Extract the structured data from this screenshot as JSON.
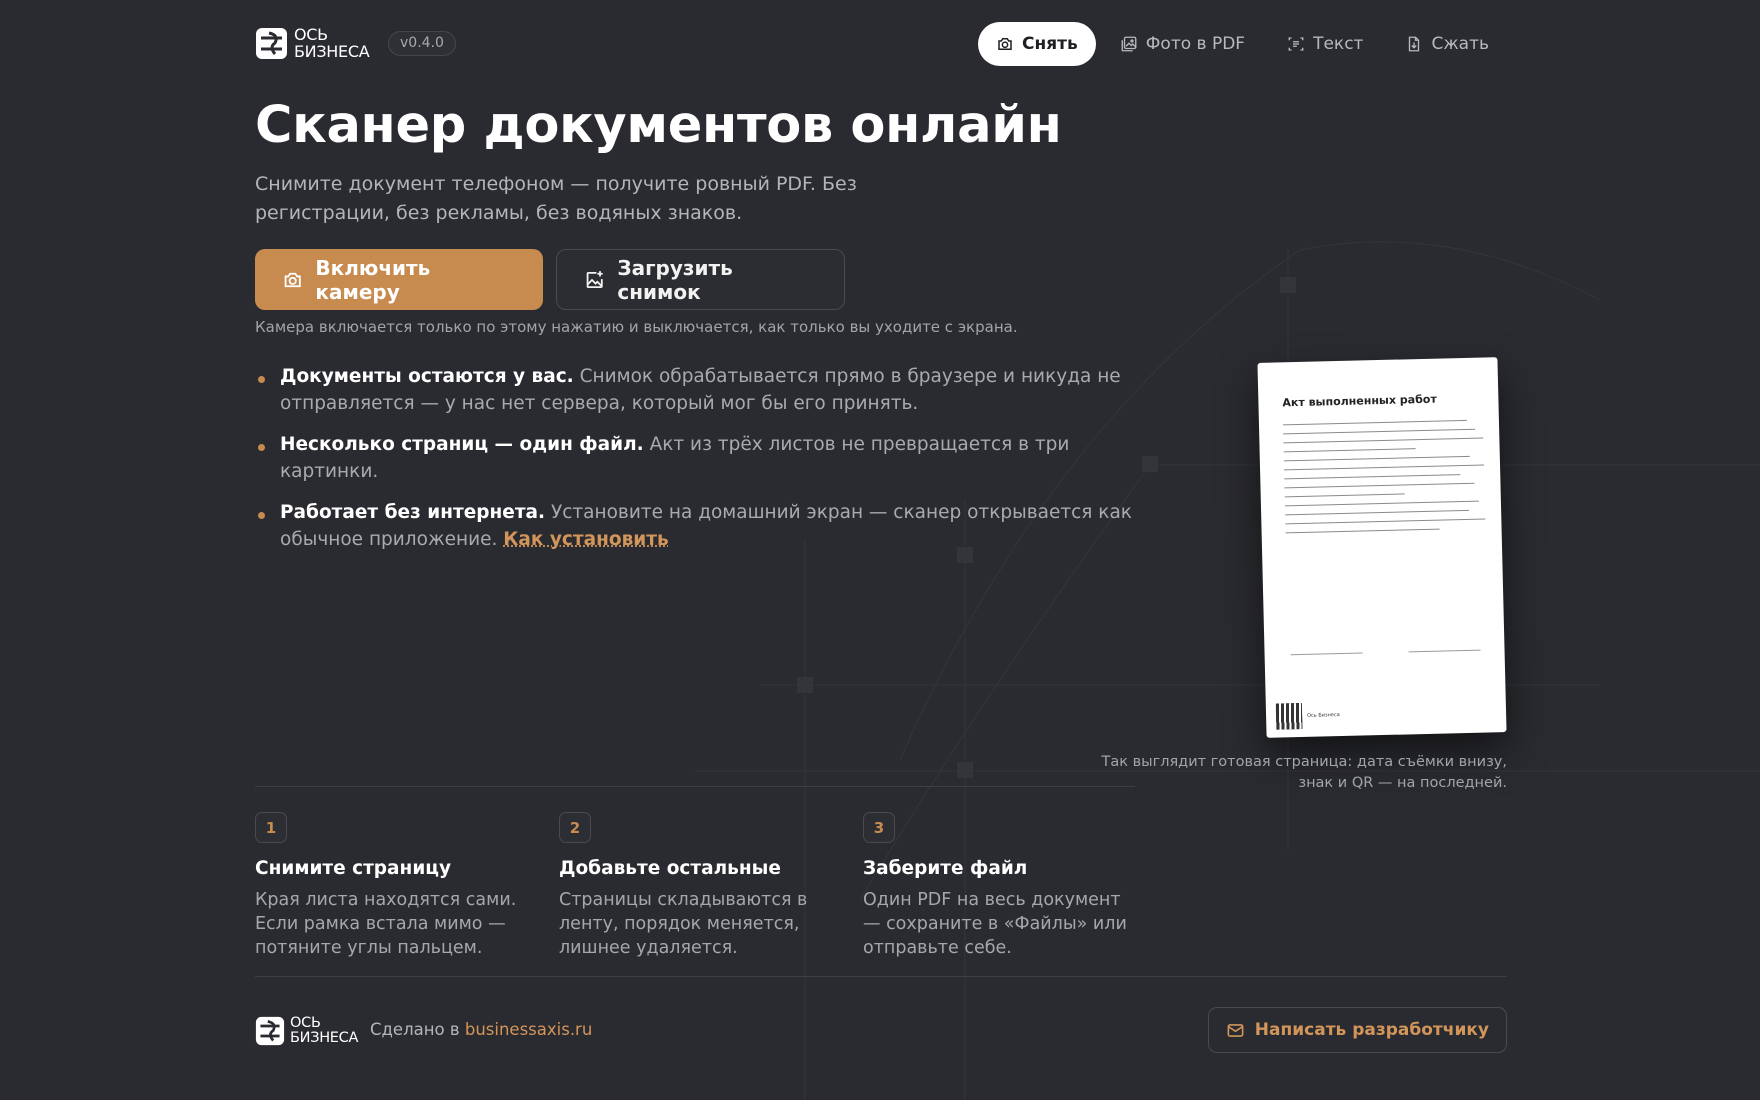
{
  "brand": {
    "logo_line1": "ОСЬ",
    "logo_line2": "БИЗНЕСА",
    "version": "v0.4.0",
    "accent_color": "#c88b4f"
  },
  "nav": {
    "items": [
      {
        "label": "Снять",
        "icon": "camera-icon",
        "active": true
      },
      {
        "label": "Фото в PDF",
        "icon": "images-icon",
        "active": false
      },
      {
        "label": "Текст",
        "icon": "text-scan-icon",
        "active": false
      },
      {
        "label": "Сжать",
        "icon": "file-compress-icon",
        "active": false
      }
    ]
  },
  "hero": {
    "title": "Сканер документов онлайн",
    "subtitle": "Снимите документ телефоном — получите ровный PDF. Без регистрации, без рекламы, без водяных знаков.",
    "primary_button": "Включить камеру",
    "secondary_button": "Загрузить снимок",
    "camera_note": "Камера включается только по этому нажатию и выключается, как только вы уходите с экрана."
  },
  "features": [
    {
      "bold": "Документы остаются у вас.",
      "text": " Снимок обрабатывается прямо в браузере и никуда не отправляется — у нас нет сервера, который мог бы его принять."
    },
    {
      "bold": "Несколько страниц — один файл.",
      "text": " Акт из трёх листов не превращается в три картинки."
    },
    {
      "bold": "Работает без интернета.",
      "text": " Установите на домашний экран — сканер открывается как обычное приложение. ",
      "link": "Как установить"
    }
  ],
  "preview": {
    "doc_title": "Акт выполненных работ",
    "doc_footer": "Ось Бизнеса",
    "caption": "Так выглядит готовая страница: дата съёмки внизу, знак и QR — на последней."
  },
  "steps": [
    {
      "num": "1",
      "title": "Снимите страницу",
      "text": "Края листа находятся сами. Если рамка встала мимо — потяните углы пальцем."
    },
    {
      "num": "2",
      "title": "Добавьте остальные",
      "text": "Страницы складываются в ленту, порядок меняется, лишнее удаляется."
    },
    {
      "num": "3",
      "title": "Заберите файл",
      "text": "Один PDF на весь документ — сохраните в «Файлы» или отправьте себе."
    }
  ],
  "footer": {
    "made_prefix": "Сделано в ",
    "made_link": "businessaxis.ru",
    "contact_button": "Написать разработчику"
  }
}
